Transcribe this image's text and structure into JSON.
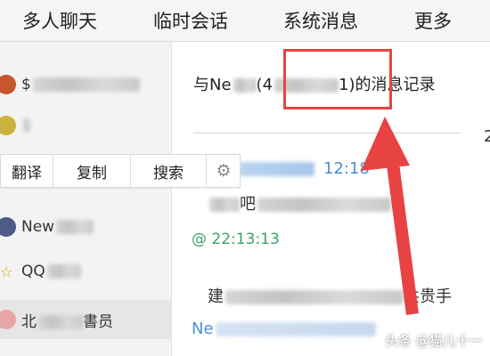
{
  "tabs": [
    {
      "label": "多人聊天"
    },
    {
      "label": "临时会话"
    },
    {
      "label": "系统消息"
    },
    {
      "label": "更多"
    }
  ],
  "contacts": [
    {
      "prefix": "$",
      "avatar_icon": "avatar-icon"
    },
    {
      "prefix": "",
      "avatar_icon": "avatar-icon"
    },
    {
      "prefix": "New",
      "avatar_icon": "avatar-icon"
    },
    {
      "prefix": "QQ",
      "avatar_icon": "star-icon"
    },
    {
      "prefix": "北",
      "suffix": "書员",
      "avatar_icon": "avatar-icon"
    }
  ],
  "popup": {
    "translate": "翻译",
    "copy": "复制",
    "search": "搜索",
    "settings_icon": "gear-icon"
  },
  "history": {
    "prefix": "与Ne",
    "id_open": "(4",
    "id_close": "1)",
    "suffix": "的消息记录"
  },
  "date_partial": "2",
  "messages": [
    {
      "time": "12:18"
    },
    {
      "text_partial": "吧"
    },
    {
      "time": "@ 22:13:13"
    },
    {
      "text_partial": "建"
    },
    {
      "text_tail": "共贵手"
    },
    {
      "sender": "Ne"
    }
  ],
  "watermark": "头条 @猫儿十一",
  "colors": {
    "highlight": "#e84343",
    "sender": "#4a8fd6",
    "time": "#3aa36a"
  }
}
